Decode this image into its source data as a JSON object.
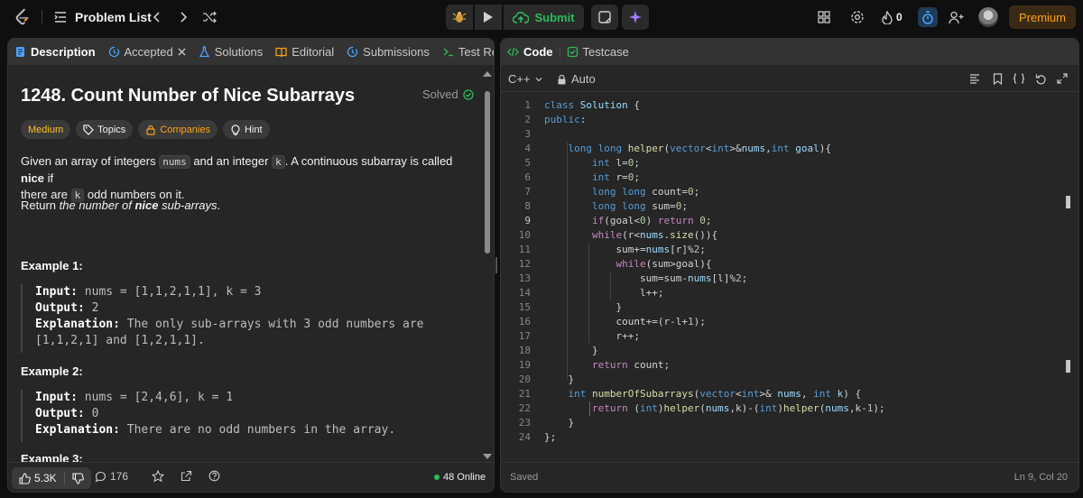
{
  "topnav": {
    "title": "Problem List",
    "submit_label": "Submit",
    "streak": "0",
    "premium_label": "Premium"
  },
  "left_tabs": [
    {
      "label": "Description"
    },
    {
      "label": "Accepted"
    },
    {
      "label": "Solutions"
    },
    {
      "label": "Editorial"
    },
    {
      "label": "Submissions"
    },
    {
      "label": "Test Re"
    }
  ],
  "problem": {
    "title": "1248. Count Number of Nice Subarrays",
    "status": "Solved",
    "chips": {
      "difficulty": "Medium",
      "topics": "Topics",
      "companies": "Companies",
      "hint": "Hint"
    },
    "desc1_a": "Given an array of integers ",
    "desc1_code1": "nums",
    "desc1_b": " and an integer ",
    "desc1_code2": "k",
    "desc1_c": ". A continuous subarray is called ",
    "desc1_bold": "nice",
    "desc1_d": " if",
    "desc2_a": "there are ",
    "desc2_code": "k",
    "desc2_b": " odd numbers on it.",
    "ret_a": "Return ",
    "ret_i1": "the number of ",
    "ret_bold": "nice",
    "ret_i2": " sub-arrays",
    "ret_end": ".",
    "examples": [
      {
        "title": "Example 1:",
        "input_label": "Input:",
        "input": " nums = [1,1,2,1,1], k = 3",
        "output_label": "Output:",
        "output": " 2",
        "expl_label": "Explanation:",
        "expl1": " The only sub-arrays with 3 odd numbers are",
        "expl2": "[1,1,2,1] and [1,2,1,1]."
      },
      {
        "title": "Example 2:",
        "input_label": "Input:",
        "input": " nums = [2,4,6], k = 1",
        "output_label": "Output:",
        "output": " 0",
        "expl_label": "Explanation:",
        "expl1": " There are no odd numbers in the array."
      },
      {
        "title": "Example 3:"
      }
    ]
  },
  "left_footer": {
    "likes": "5.3K",
    "comments": "176",
    "online": "48 Online"
  },
  "right_tabs": [
    {
      "label": "Code"
    },
    {
      "label": "Testcase"
    }
  ],
  "editor": {
    "language": "C++",
    "mode": "Auto",
    "saved": "Saved",
    "cursor": "Ln 9, Col 20"
  },
  "colors": {
    "accent": "#ffa116",
    "submit": "#2cbb5d",
    "medium": "#ffc01e"
  }
}
